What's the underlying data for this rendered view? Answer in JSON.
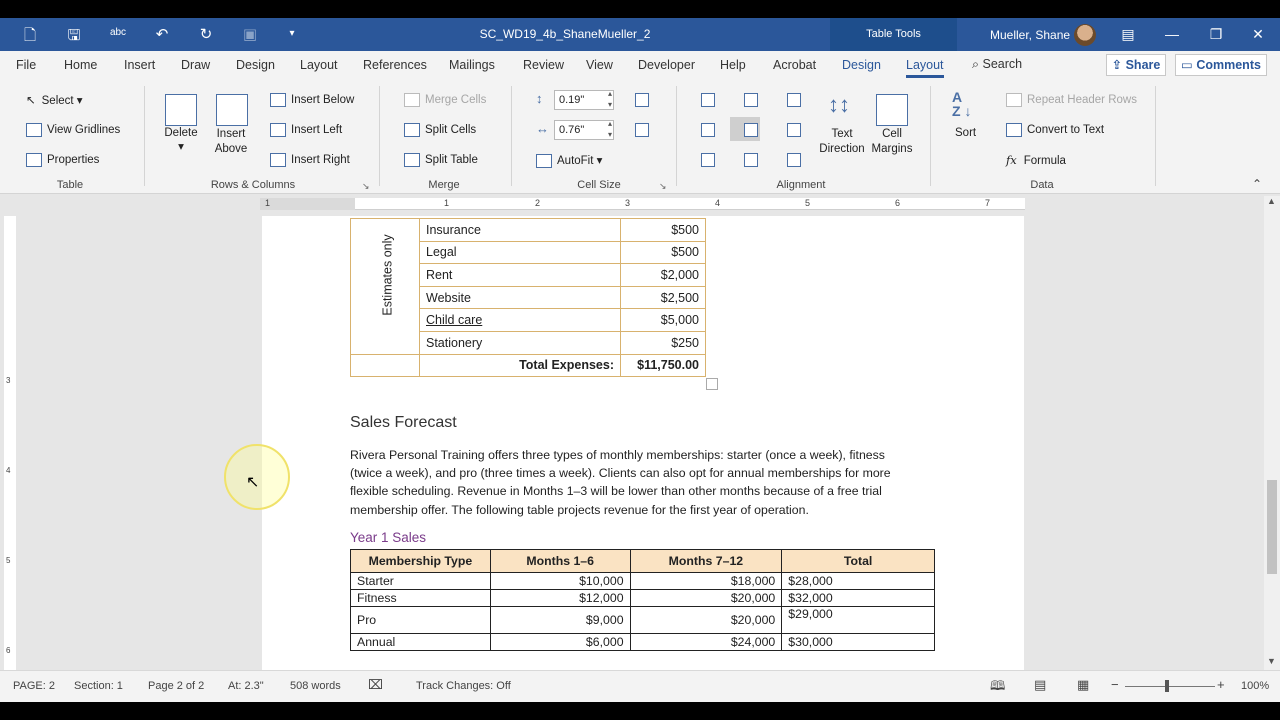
{
  "window": {
    "title": "SC_WD19_4b_ShaneMueller_2",
    "context_tab": "Table Tools",
    "user": "Mueller, Shane"
  },
  "menu": {
    "tabs": [
      "File",
      "Home",
      "Insert",
      "Draw",
      "Design",
      "Layout",
      "References",
      "Mailings",
      "Review",
      "View",
      "Developer",
      "Help",
      "Acrobat",
      "Design",
      "Layout"
    ],
    "search": "Search",
    "share": "Share",
    "comments": "Comments"
  },
  "ribbon": {
    "table": {
      "select": "Select",
      "gridlines": "View Gridlines",
      "properties": "Properties",
      "label": "Table"
    },
    "rows_cols": {
      "delete": "Delete",
      "insert_above": "Insert Above",
      "insert_below": "Insert Below",
      "insert_left": "Insert Left",
      "insert_right": "Insert Right",
      "label": "Rows & Columns"
    },
    "merge": {
      "merge_cells": "Merge Cells",
      "split_cells": "Split Cells",
      "split_table": "Split Table",
      "label": "Merge"
    },
    "cell_size": {
      "height": "0.19\"",
      "width": "0.76\"",
      "autofit": "AutoFit",
      "label": "Cell Size"
    },
    "alignment": {
      "text_direction": "Text Direction",
      "cell_margins": "Cell Margins",
      "label": "Alignment"
    },
    "data": {
      "sort": "Sort",
      "repeat_header": "Repeat Header Rows",
      "convert": "Convert to Text",
      "formula": "Formula",
      "label": "Data"
    }
  },
  "document": {
    "vertical_label": "Estimates only",
    "expenses": [
      {
        "item": "Insurance",
        "amount": "$500"
      },
      {
        "item": "Legal",
        "amount": "$500"
      },
      {
        "item": "Rent",
        "amount": "$2,000"
      },
      {
        "item": "Website",
        "amount": "$2,500"
      },
      {
        "item": "Child care",
        "amount": "$5,000"
      },
      {
        "item": "Stationery",
        "amount": "$250"
      }
    ],
    "total_label": "Total Expenses:",
    "total_value": "$11,750.00",
    "heading": "Sales Forecast",
    "paragraph": "Rivera Personal Training offers three types of monthly memberships: starter (once a week), fitness (twice a week), and pro (three times a week). Clients can also opt for annual memberships for more flexible scheduling. Revenue in Months 1–3 will be lower than other months because of a free trial membership offer. The following table projects revenue for the first year of operation.",
    "subheading": "Year 1 Sales",
    "sales_headers": [
      "Membership Type",
      "Months 1–6",
      "Months 7–12",
      "Total"
    ],
    "sales_rows": [
      [
        "Starter",
        "$10,000",
        "$18,000",
        "$28,000"
      ],
      [
        "Fitness",
        "$12,000",
        "$20,000",
        "$32,000"
      ],
      [
        "Pro",
        "$9,000",
        "$20,000",
        "$29,000"
      ],
      [
        "Annual",
        "$6,000",
        "$24,000",
        "$30,000"
      ]
    ]
  },
  "status": {
    "page": "PAGE: 2",
    "section": "Section: 1",
    "pages": "Page 2 of 2",
    "at": "At: 2.3\"",
    "words": "508 words",
    "track": "Track Changes: Off",
    "zoom": "100%"
  },
  "ruler": {
    "h": [
      "1",
      "1",
      "2",
      "3",
      "4",
      "5",
      "6",
      "7"
    ],
    "v": [
      "3",
      "4",
      "5",
      "6"
    ]
  }
}
